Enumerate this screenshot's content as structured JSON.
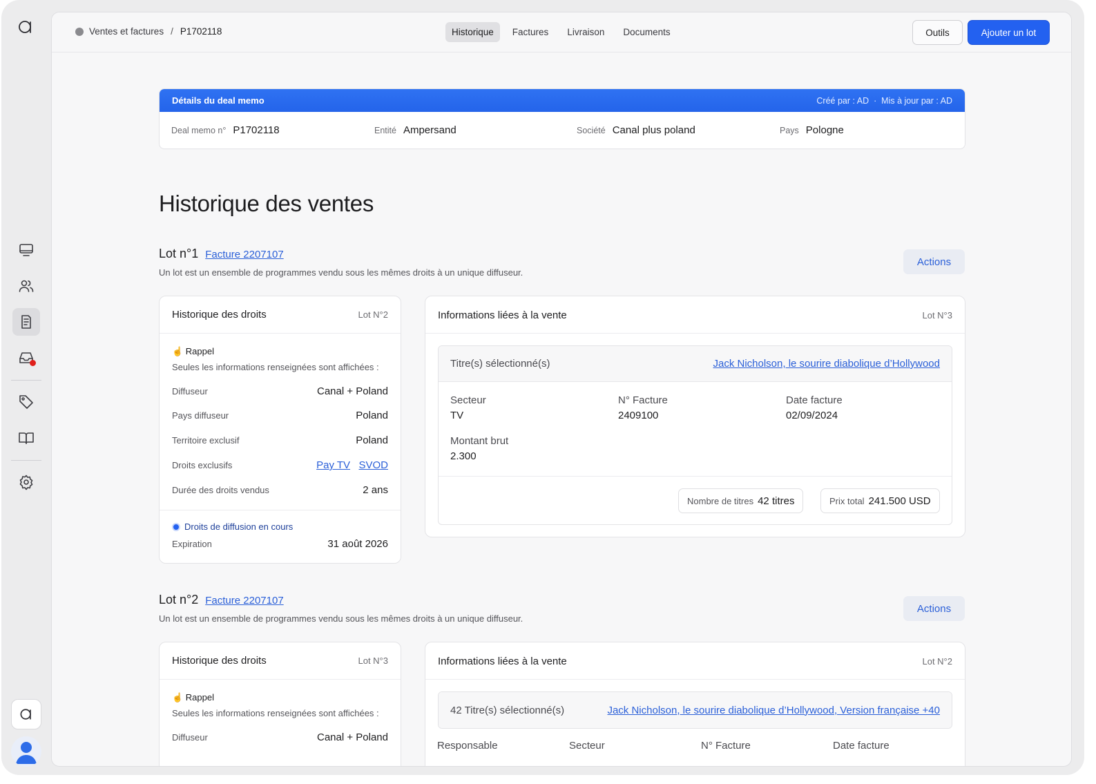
{
  "breadcrumb": {
    "parent": "Ventes et factures",
    "separator": "/",
    "current": "P1702118"
  },
  "tabs": [
    "Historique",
    "Factures",
    "Livraison",
    "Documents"
  ],
  "toolbar": {
    "tools_label": "Outils",
    "add_lot_label": "Ajouter un lot"
  },
  "memo": {
    "title": "Détails du deal memo",
    "meta": "Créé par : AD  ·  Mis à jour par : AD",
    "fields": [
      {
        "label": "Deal memo n°",
        "value": "P1702118"
      },
      {
        "label": "Entité",
        "value": "Ampersand"
      },
      {
        "label": "Société",
        "value": "Canal plus poland"
      },
      {
        "label": "Pays",
        "value": "Pologne"
      }
    ]
  },
  "page_title": "Historique des ventes",
  "lots": [
    {
      "title": "Lot n°1",
      "invoice_link": "Facture 2207107",
      "subtitle": "Un lot est un ensemble de programmes vendu sous les mêmes droits à un unique diffuseur.",
      "actions_label": "Actions",
      "rights": {
        "title": "Historique des droits",
        "lot_ref": "Lot N°2",
        "reminder": "☝ Rappel",
        "reminder_sub": "Seules les informations renseignées sont affichées :",
        "rows": [
          {
            "label": "Diffuseur",
            "value": "Canal + Poland"
          },
          {
            "label": "Pays diffuseur",
            "value": "Poland"
          },
          {
            "label": "Territoire exclusif",
            "value": "Poland"
          },
          {
            "label": "Droits exclusifs",
            "links": [
              "Pay TV",
              "SVOD"
            ]
          },
          {
            "label": "Durée des droits vendus",
            "value": "2 ans"
          }
        ],
        "status": "Droits de diffusion en cours",
        "expiration_label": "Expiration",
        "expiration_value": "31 août 2026"
      },
      "sale": {
        "title": "Informations liées à la vente",
        "lot_ref": "Lot N°3",
        "selected_label": "Titre(s) sélectionné(s)",
        "selected_link": "Jack Nicholson, le sourire diabolique d’Hollywood",
        "cells": [
          {
            "label": "Secteur",
            "value": "TV"
          },
          {
            "label": "N° Facture",
            "value": "2409100"
          },
          {
            "label": "Date facture",
            "value": "02/09/2024"
          },
          {
            "label": "Montant brut",
            "value": "2.300"
          }
        ],
        "count_label": "Nombre de titres",
        "count_value": "42 titres",
        "total_label": "Prix total",
        "total_value": "241.500 USD"
      }
    },
    {
      "title": "Lot n°2",
      "invoice_link": "Facture 2207107",
      "subtitle": "Un lot est un ensemble de programmes vendu sous les mêmes droits à un unique diffuseur.",
      "actions_label": "Actions",
      "rights": {
        "title": "Historique des droits",
        "lot_ref": "Lot N°3",
        "reminder": "☝ Rappel",
        "reminder_sub": "Seules les informations renseignées sont affichées :",
        "rows": [
          {
            "label": "Diffuseur",
            "value": "Canal + Poland"
          }
        ]
      },
      "sale": {
        "title": "Informations liées à la vente",
        "lot_ref": "Lot N°2",
        "selected_label": "42 Titre(s) sélectionné(s)",
        "selected_link": "Jack Nicholson, le sourire diabolique d’Hollywood, Version française +40",
        "columns": [
          "Responsable",
          "Secteur",
          "N° Facture",
          "Date facture"
        ]
      }
    }
  ],
  "icons": {
    "logo": "app-logo-icon",
    "rail": [
      "monitor-icon",
      "users-icon",
      "document-list-icon",
      "inbox-icon",
      "tag-icon",
      "book-icon",
      "gear-icon"
    ]
  },
  "colors": {
    "accent": "#2361f0",
    "link": "#2a5fd8",
    "notification": "#e0201b"
  }
}
